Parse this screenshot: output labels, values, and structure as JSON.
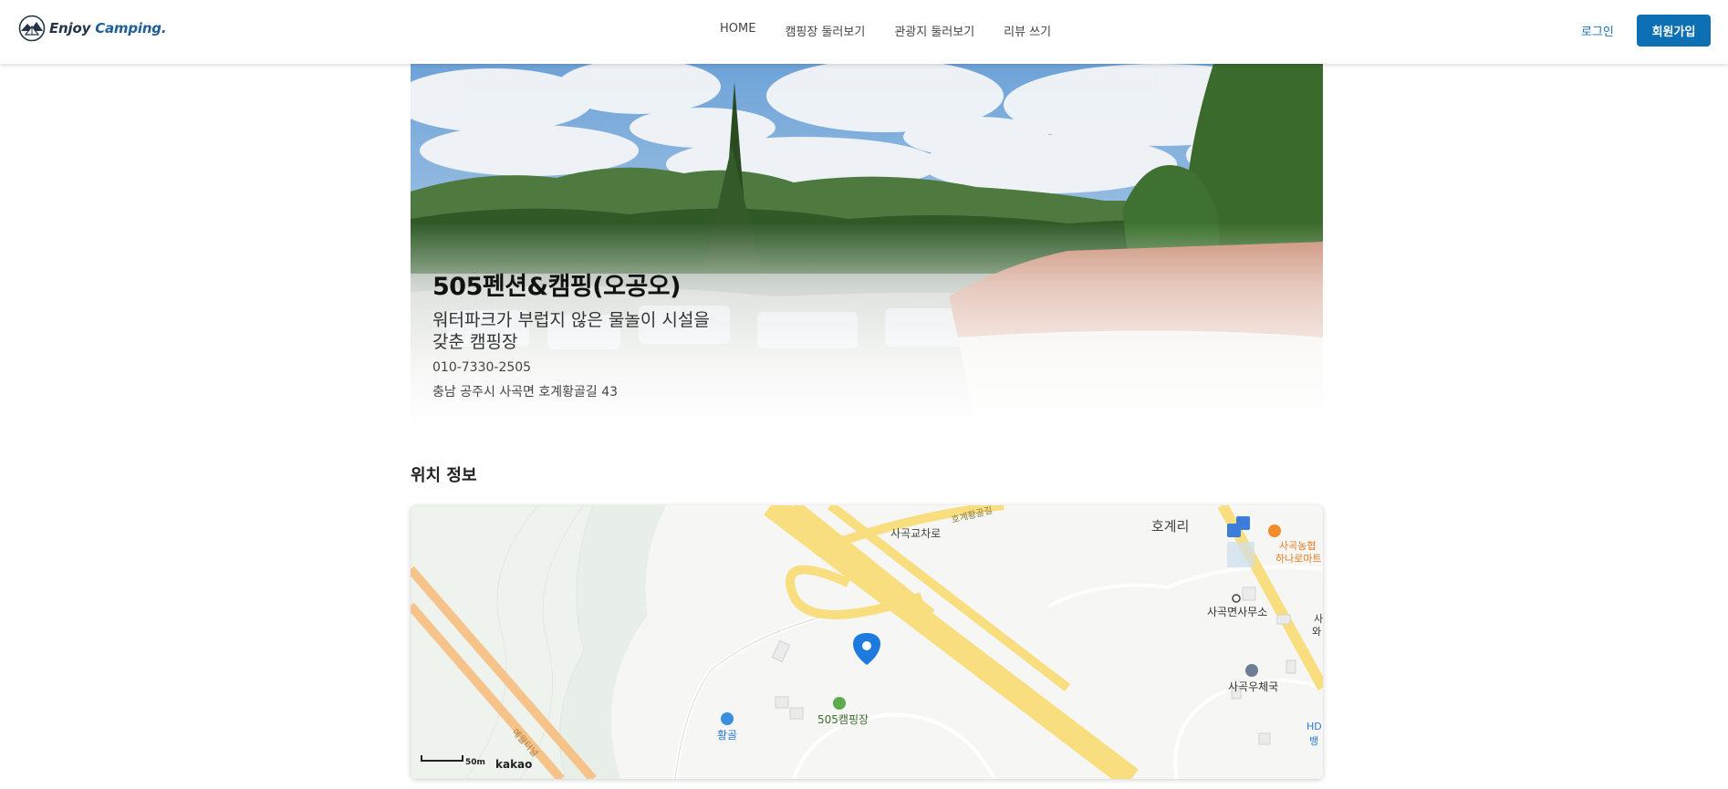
{
  "header": {
    "logo_text_1": "Enjoy",
    "logo_text_2": "Camping.",
    "nav": [
      "HOME",
      "캠핑장 둘러보기",
      "관광지 둘러보기",
      "리뷰 쓰기"
    ],
    "login": "로그인",
    "signup": "회원가입"
  },
  "hero": {
    "title": "505펜션&캠핑(오공오)",
    "description_line1": "워터파크가 부럽지 않은 물놀이 시설을",
    "description_line2": "갖춘 캠핑장",
    "phone": "010-7330-2505",
    "address": "충남 공주시 사곡면 호계황골길 43"
  },
  "location": {
    "title": "위치 정보",
    "map": {
      "labels": {
        "road_junction": "사곡교차로",
        "village": "호계리",
        "store_line1": "사곡농협",
        "store_line2": "하나로마트",
        "office": "사곡면사무소",
        "post_office": "사곡우체국",
        "campsite": "505캠핑장",
        "hwanggol": "황골",
        "tunnel": "예월터널",
        "top_road": "호계황골길",
        "edge_1": "사",
        "edge_2": "와",
        "edge_3": "HD",
        "edge_4": "뱅"
      },
      "scale": "50m",
      "provider": "kakao"
    }
  },
  "colors": {
    "accent": "#0d6fb4",
    "link": "#1a73b8",
    "marker": "#1f7ae0"
  }
}
